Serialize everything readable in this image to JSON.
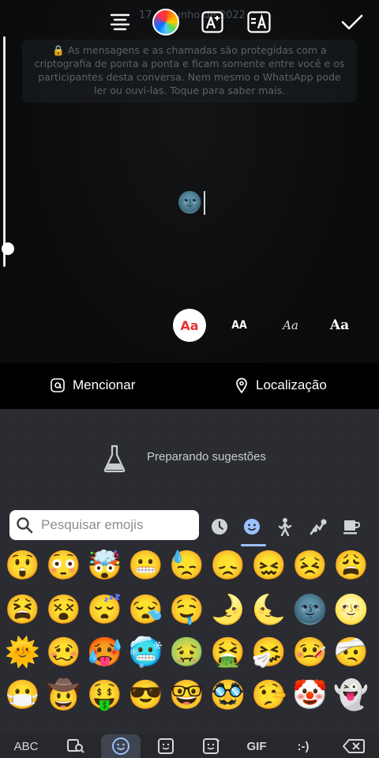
{
  "editor": {
    "date_text": "17 de junho de 2022",
    "e2e_notice": "🔒 As mensagens e as chamadas são protegidas com a criptografia de ponta a ponta e ficam somente entre você e os participantes desta conversa. Nem mesmo o WhatsApp pode ler ou ouvi-las. Toque para saber mais.",
    "typed_emoji": "🌚",
    "font_options": [
      "Aa",
      "AA",
      "Aa",
      "Aa"
    ]
  },
  "toolbar": {
    "icons": [
      "align-center-icon",
      "color-wheel-icon",
      "text-style-add-icon",
      "text-background-icon",
      "check-icon"
    ]
  },
  "mention_bar": {
    "mention_label": "Mencionar",
    "location_label": "Localização"
  },
  "keyboard": {
    "suggestions_label": "Preparando sugestões",
    "search_placeholder": "Pesquisar emojis",
    "categories": [
      "recent-icon",
      "smiley-icon",
      "person-icon",
      "animals-icon",
      "food-icon"
    ],
    "emoji_rows": [
      [
        "😲",
        "😳",
        "🤯",
        "😬",
        "😓",
        "😞",
        "😖",
        "😣",
        "😩"
      ],
      [
        "😫",
        "😵",
        "😴",
        "😪",
        "🤤",
        "🌛",
        "🌜",
        "🌚",
        "🌝"
      ],
      [
        "🌞",
        "🥴",
        "🥵",
        "🥶",
        "🤢",
        "🤮",
        "🤧",
        "🤒",
        "🤕"
      ],
      [
        "😷",
        "🤠",
        "🤑",
        "😎",
        "🤓",
        "🥸",
        "🤥",
        "🤡",
        "👻"
      ]
    ],
    "bottom": {
      "abc": "ABC",
      "gif": "GIF",
      "emoticon": ":-)"
    }
  },
  "colors": {
    "accent_red": "#e3342f",
    "selected_tab": "#9bc1ff",
    "keyboard_bg": "#2a2c31"
  }
}
